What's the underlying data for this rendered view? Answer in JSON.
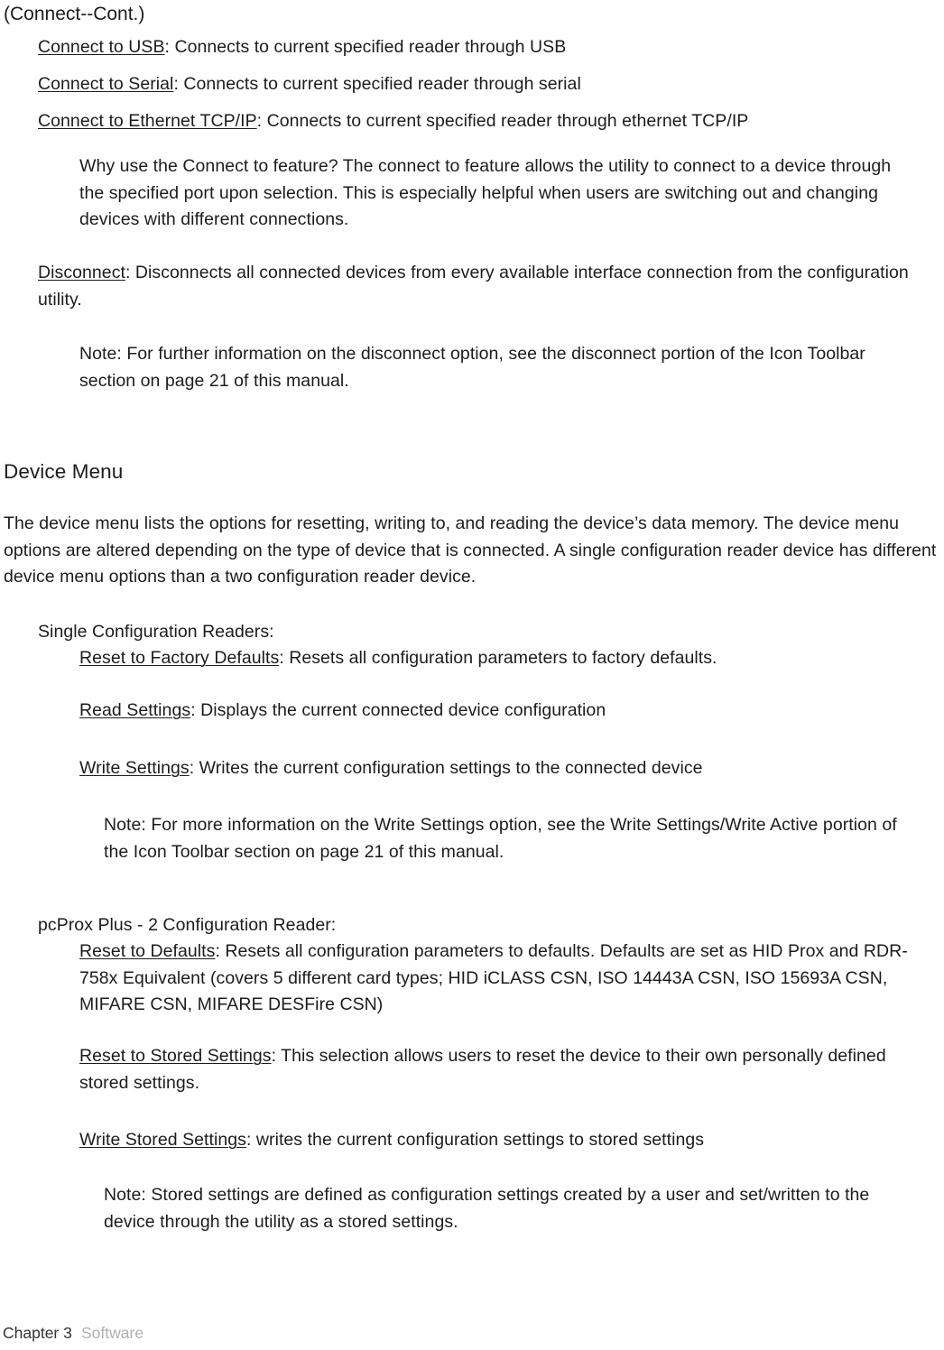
{
  "page": {
    "continued_title": "(Connect--Cont.)",
    "connect_items": [
      {
        "term": "Connect to USB",
        "desc": ": Connects  to current specified reader through USB"
      },
      {
        "term": "Connect to Serial",
        "desc": ": Connects to current specified reader through serial"
      },
      {
        "term": "Connect to Ethernet TCP/IP",
        "desc": ": Connects to current specified reader through ethernet TCP/IP"
      }
    ],
    "why_connect_note": "Why use the Connect to feature? The connect to feature allows the utility to connect to a device through the specified port upon selection. This is especially helpful when users are switching out and changing devices with different connections.",
    "disconnect": {
      "term": "Disconnect",
      "desc": ": Disconnects all connected devices from every available interface connection from the configuration utility."
    },
    "disconnect_note": "Note: For further  information  on the disconnect  option,  see the disconnect portion of the Icon  Toolbar   section   on  page  21 of this manual.",
    "device_menu": {
      "heading": "Device Menu",
      "intro": "The device menu lists the options for resetting, writing to, and reading the device’s data memory. The device menu options  are altered depending on the type of device that is connected.  A single configuration  reader device has different  device menu options  than a two configuration  reader device."
    },
    "single_config": {
      "heading": "Single Configuration Readers:",
      "items": [
        {
          "term": "Reset to Factory Defaults",
          "desc": ":  Resets all configuration  parameters to factory defaults."
        },
        {
          "term": "Read Settings",
          "desc": ":  Displays  the current  connected device configuration"
        },
        {
          "term": "Write Settings",
          "desc": ": Writes the current configuration settings to the connected device"
        }
      ],
      "write_settings_note": "Note: For more information  on the Write  Settings option,  see the Write  Settings/Write Active portion of the Icon  Toolbar   section   on  page  21 of this manual."
    },
    "two_config": {
      "heading": "pcProx Plus - 2 Configuration Reader:",
      "items": [
        {
          "term": "Reset to Defaults",
          "desc": ":  Resets all configuration  parameters to defaults. Defaults  are set as HID Prox and RDR-758x Equivalent (covers 5 different  card types; HID iCLASS CSN, ISO 14443A CSN, ISO 15693A  CSN, MIFARE  CSN, MIFARE  DESFire CSN)"
        },
        {
          "term": "Reset to Stored Settings",
          "desc": ": This selection allows  users to reset the device to their own personally defined stored settings."
        },
        {
          "term": "Write Stored Settings",
          "desc": ": writes the current configuration settings to stored settings"
        }
      ],
      "stored_settings_note": "Note: Stored settings  are defined as configuration  settings  created by a user and set/written to the device through  the utility as a stored  settings."
    },
    "footer": {
      "chapter": "Chapter 3",
      "section": "Software"
    }
  }
}
